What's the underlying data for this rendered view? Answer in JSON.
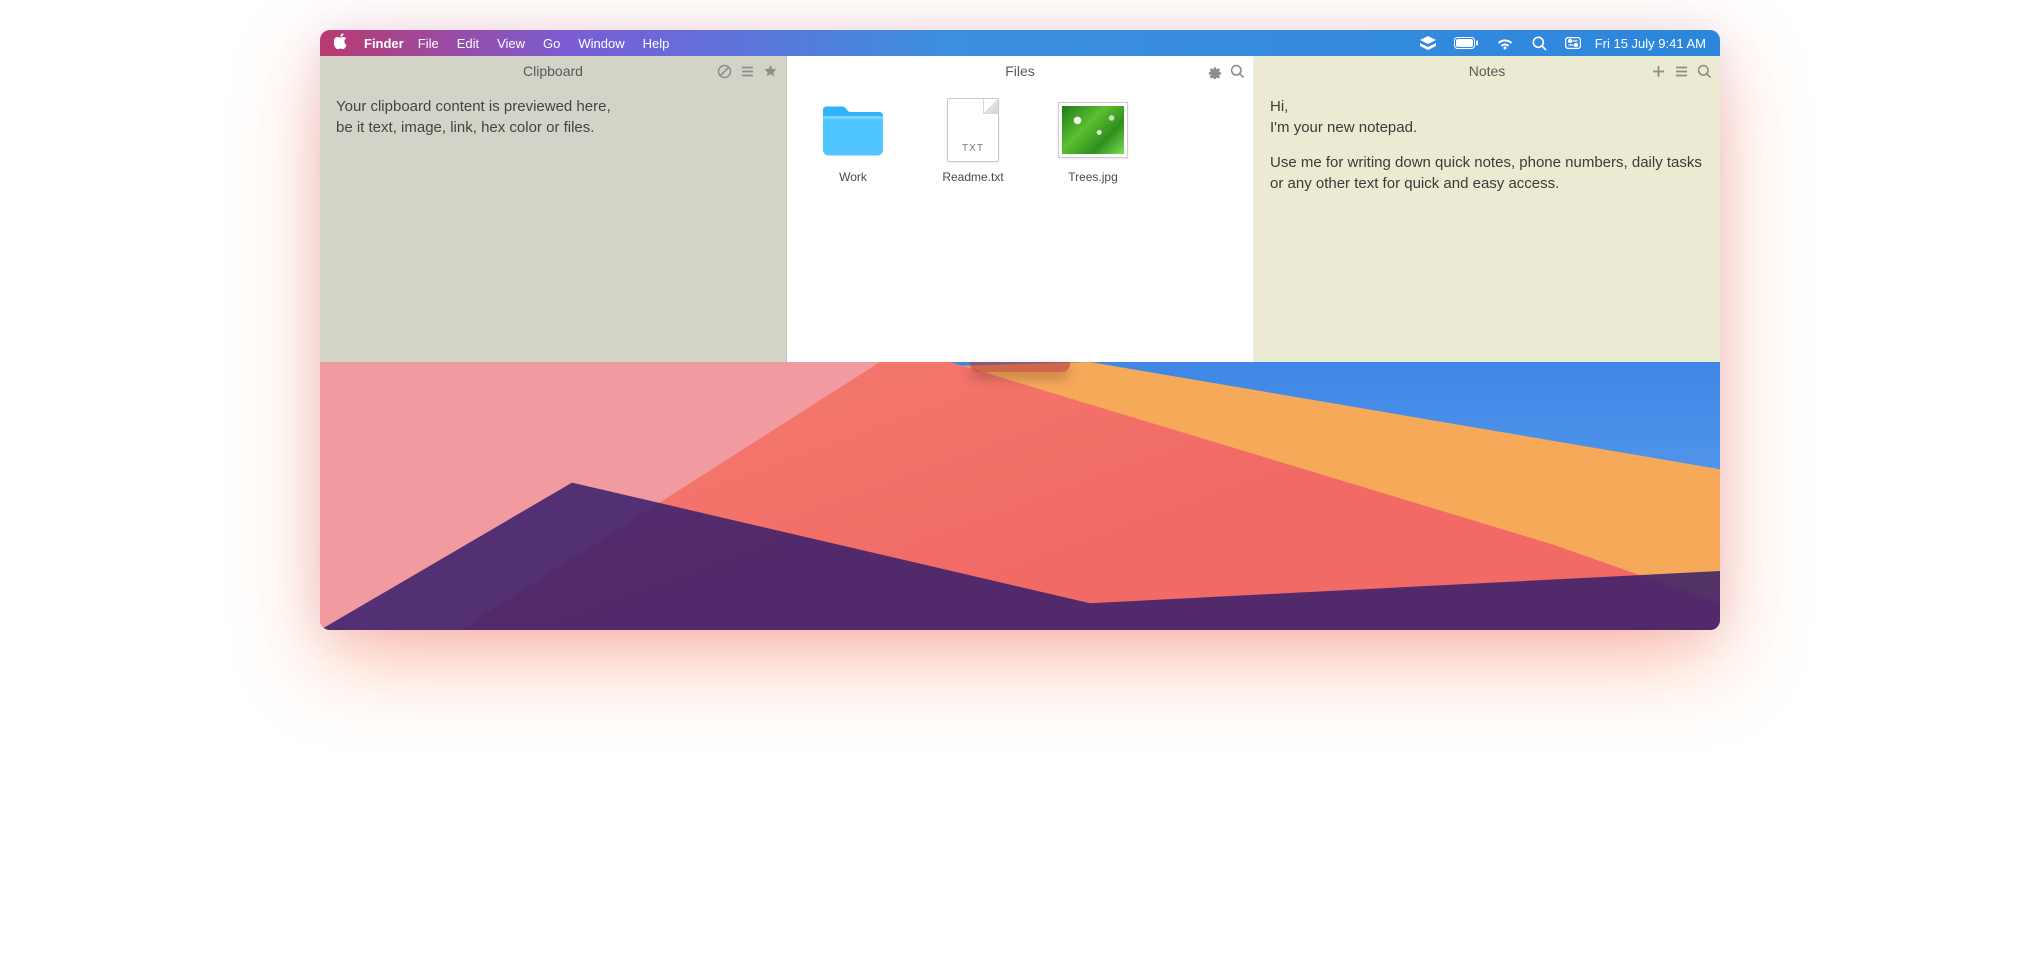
{
  "menubar": {
    "app": "Finder",
    "items": [
      "File",
      "Edit",
      "View",
      "Go",
      "Window",
      "Help"
    ],
    "clock": "Fri 15 July  9:41 AM"
  },
  "clipboard": {
    "title": "Clipboard",
    "line1": "Your clipboard content is previewed here,",
    "line2": "be it text, image, link, hex color or files."
  },
  "files": {
    "title": "Files",
    "items": [
      {
        "name": "Work",
        "kind": "folder"
      },
      {
        "name": "Readme.txt",
        "kind": "txt",
        "ext": "TXT"
      },
      {
        "name": "Trees.jpg",
        "kind": "image"
      }
    ]
  },
  "notes": {
    "title": "Notes",
    "p1a": "Hi,",
    "p1b": "I'm your new notepad.",
    "p2": "Use me for writing down quick notes, phone numbers, daily tasks or any other text for quick and easy access."
  }
}
